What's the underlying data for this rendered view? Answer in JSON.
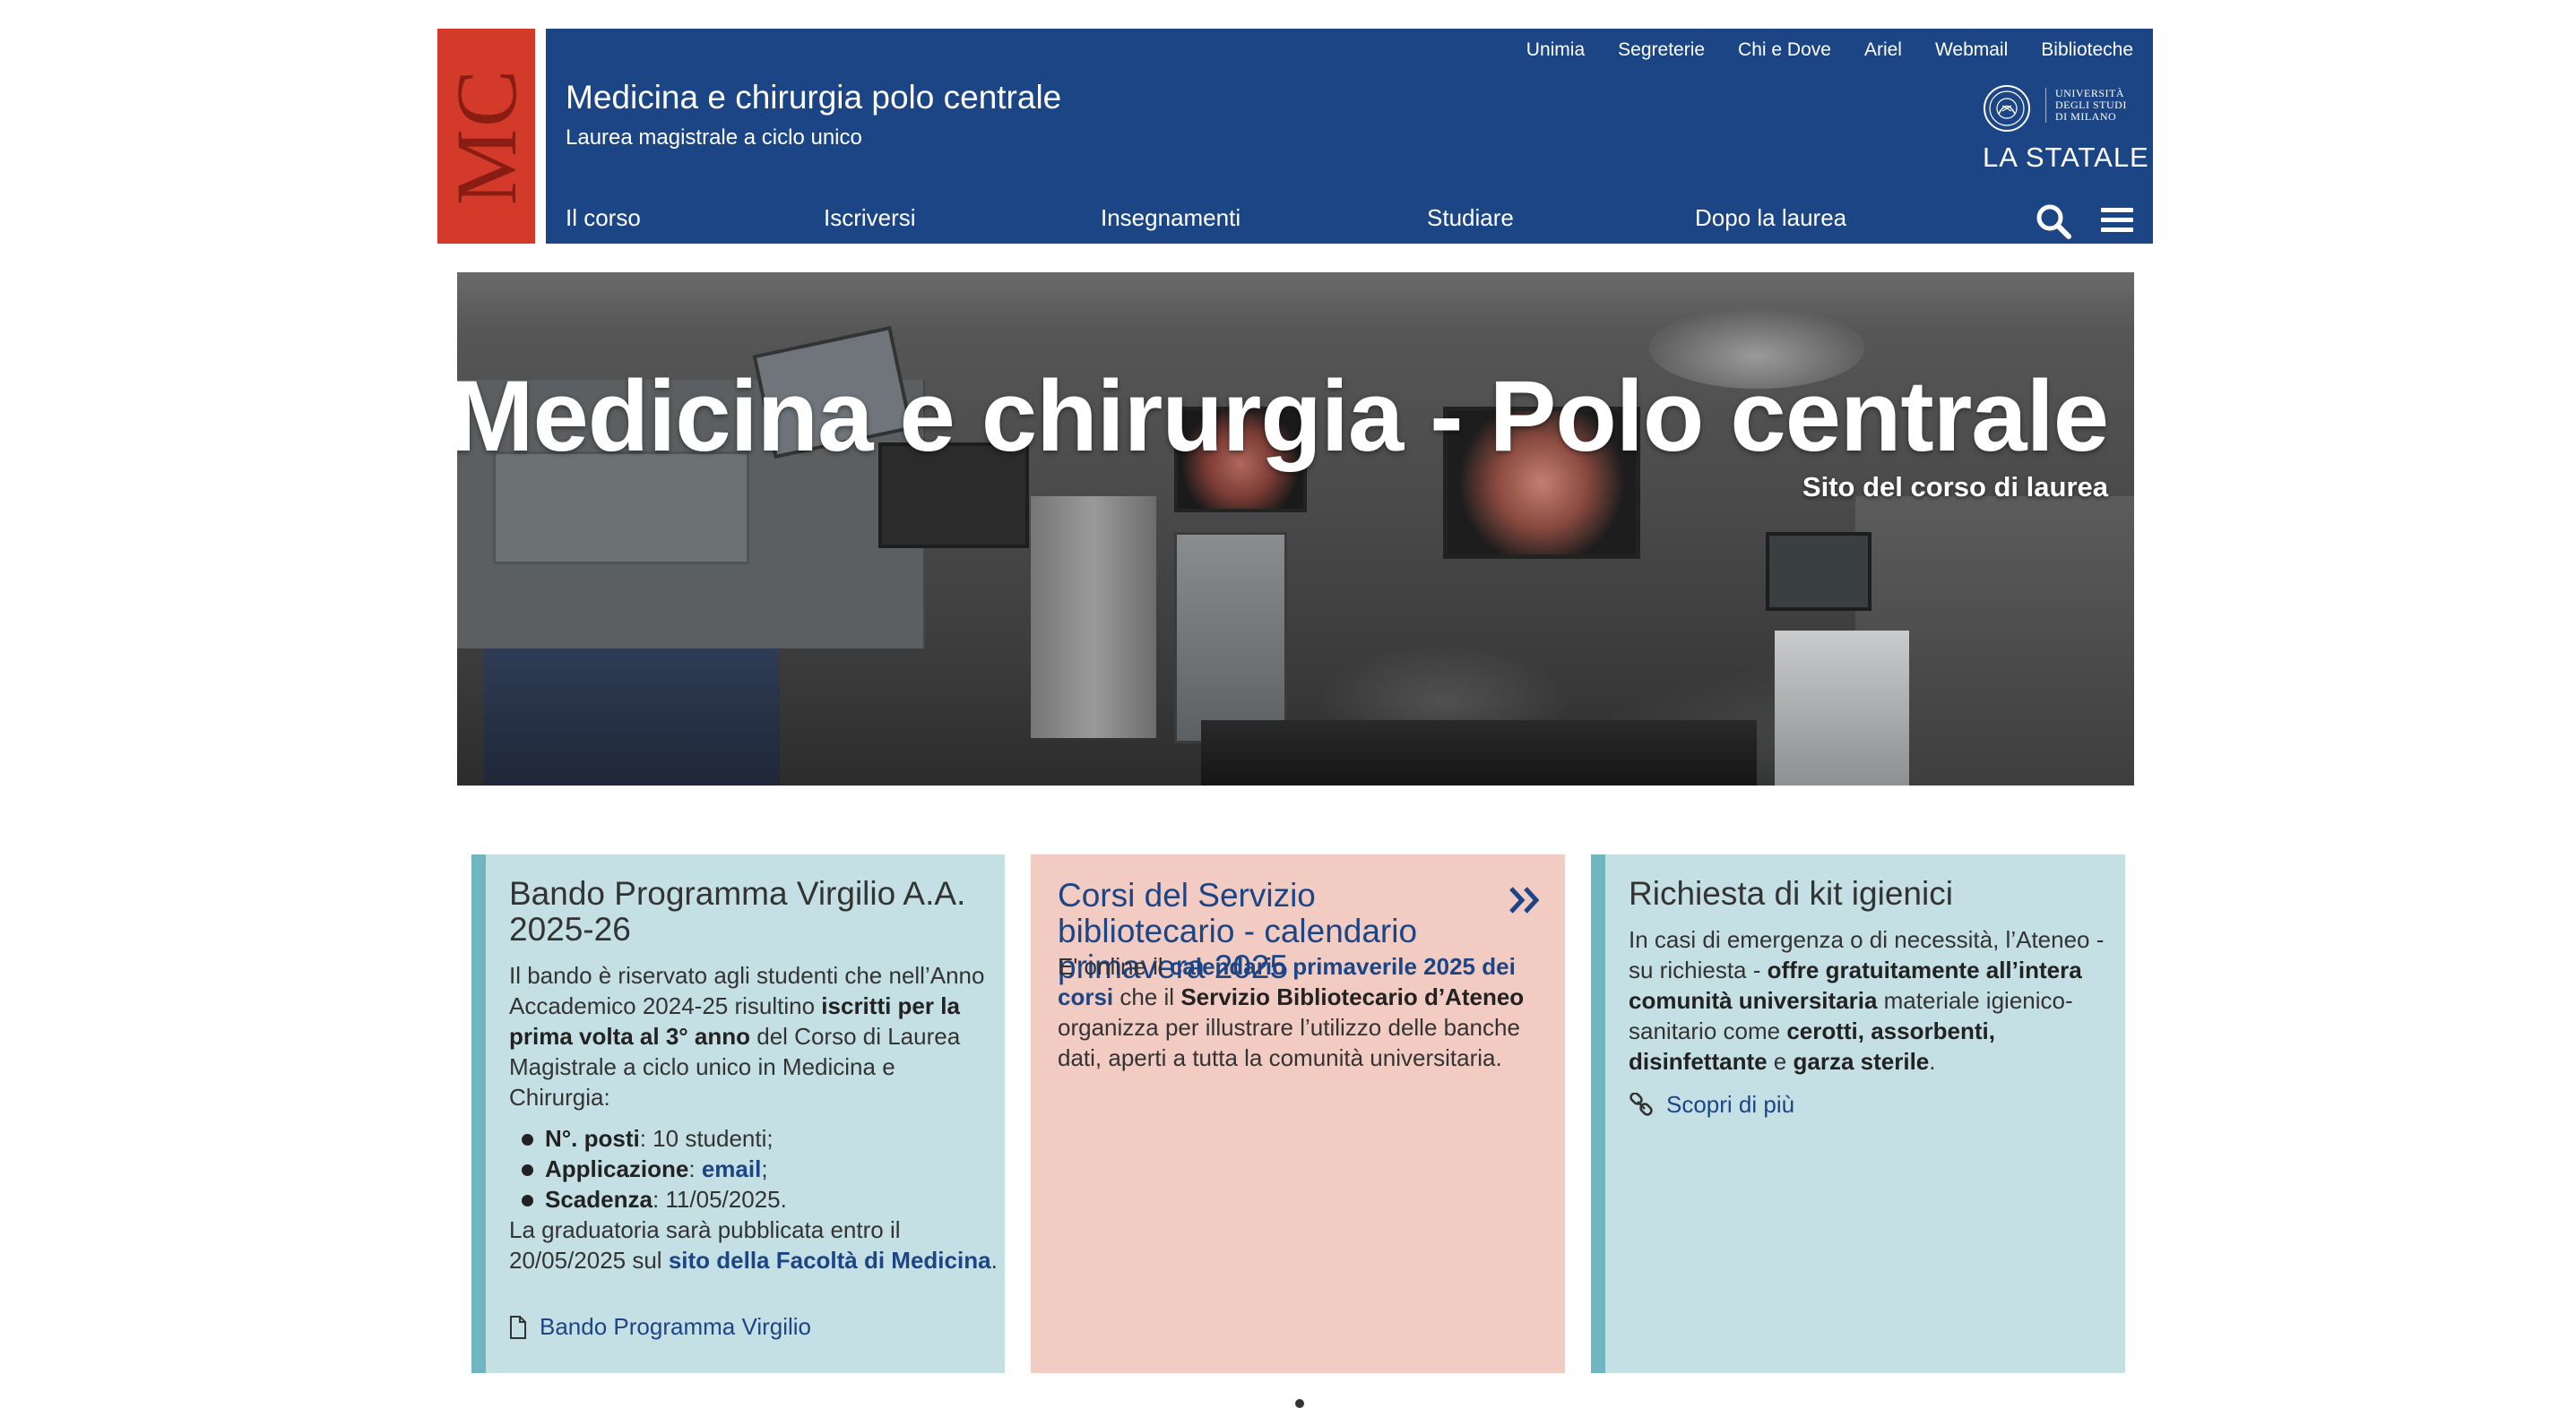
{
  "header": {
    "logo_text": "MC",
    "title": "Medicina e chirurgia polo centrale",
    "subtitle": "Laurea magistrale a ciclo unico",
    "top_links": [
      "Unimia",
      "Segreterie",
      "Chi e Dove",
      "Ariel",
      "Webmail",
      "Biblioteche"
    ],
    "university": {
      "name_lines": [
        "UNIVERSITÀ",
        "DEGLI STUDI",
        "DI MILANO"
      ],
      "brand": "LA STATALE"
    },
    "nav": [
      "Il corso",
      "Iscriversi",
      "Insegnamenti",
      "Studiare",
      "Dopo la laurea"
    ],
    "search_icon": "search-icon",
    "menu_icon": "hamburger-menu-icon",
    "colors": {
      "header_blue": "#1c4585",
      "logo_red": "#d43a2a"
    }
  },
  "hero": {
    "title": "Medicina e chirurgia - Polo centrale",
    "subtitle": "Sito del corso di laurea"
  },
  "cards": [
    {
      "title": "Bando Programma Virgilio A.A. 2025-26",
      "intro_1": "Il bando è riservato agli studenti che nell’Anno Accademico 2024-25 risultino ",
      "intro_bold": "iscritti per la prima volta al 3° anno",
      "intro_2": " del Corso di Laurea Magistrale a ciclo unico in Medicina e Chirurgia:",
      "items": [
        {
          "label": "N°. posti",
          "text": ": 10 studenti;"
        },
        {
          "label": "Applicazione",
          "text": ": ",
          "link": "email",
          "after": ";"
        },
        {
          "label": "Scadenza",
          "text": ": 11/05/2025."
        }
      ],
      "outro_1": "La graduatoria sarà pubblicata entro il 20/05/2025 sul ",
      "outro_link": "sito della Facoltà di Medicina",
      "outro_2": ".",
      "doc_link": "Bando Programma Virgilio",
      "doc_icon": "document-icon",
      "color_bg": "#c5e0e5",
      "color_border": "#6fb6c2"
    },
    {
      "title": "Corsi del Servizio bibliotecario - calendario primavera 2025",
      "arrow_icon": "double-chevron-right-icon",
      "text_1": "E' online il ",
      "link": "calendario primaverile 2025 dei corsi",
      "text_2": " che il ",
      "bold": "Servizio Bibliotecario d’Ateneo",
      "text_3": " organizza per illustrare l’utilizzo delle banche dati, aperti a tutta la comunità universitaria.",
      "color_bg": "#f2cbc3"
    },
    {
      "title": "Richiesta di kit igienici",
      "text_1": "In casi di emergenza o di necessità, l’Ateneo - su richiesta - ",
      "bold_1": "offre gratuitamente all’intera comunità universitaria",
      "text_2": " materiale igienico-sanitario come ",
      "bold_2": "cerotti, assorbenti, disinfettante",
      "text_3": " e ",
      "bold_3": "garza sterile",
      "text_4": ".",
      "more_link": "Scopri di più",
      "link_icon": "chain-link-icon",
      "color_bg": "#c5e0e5",
      "color_border": "#6fb6c2"
    }
  ]
}
